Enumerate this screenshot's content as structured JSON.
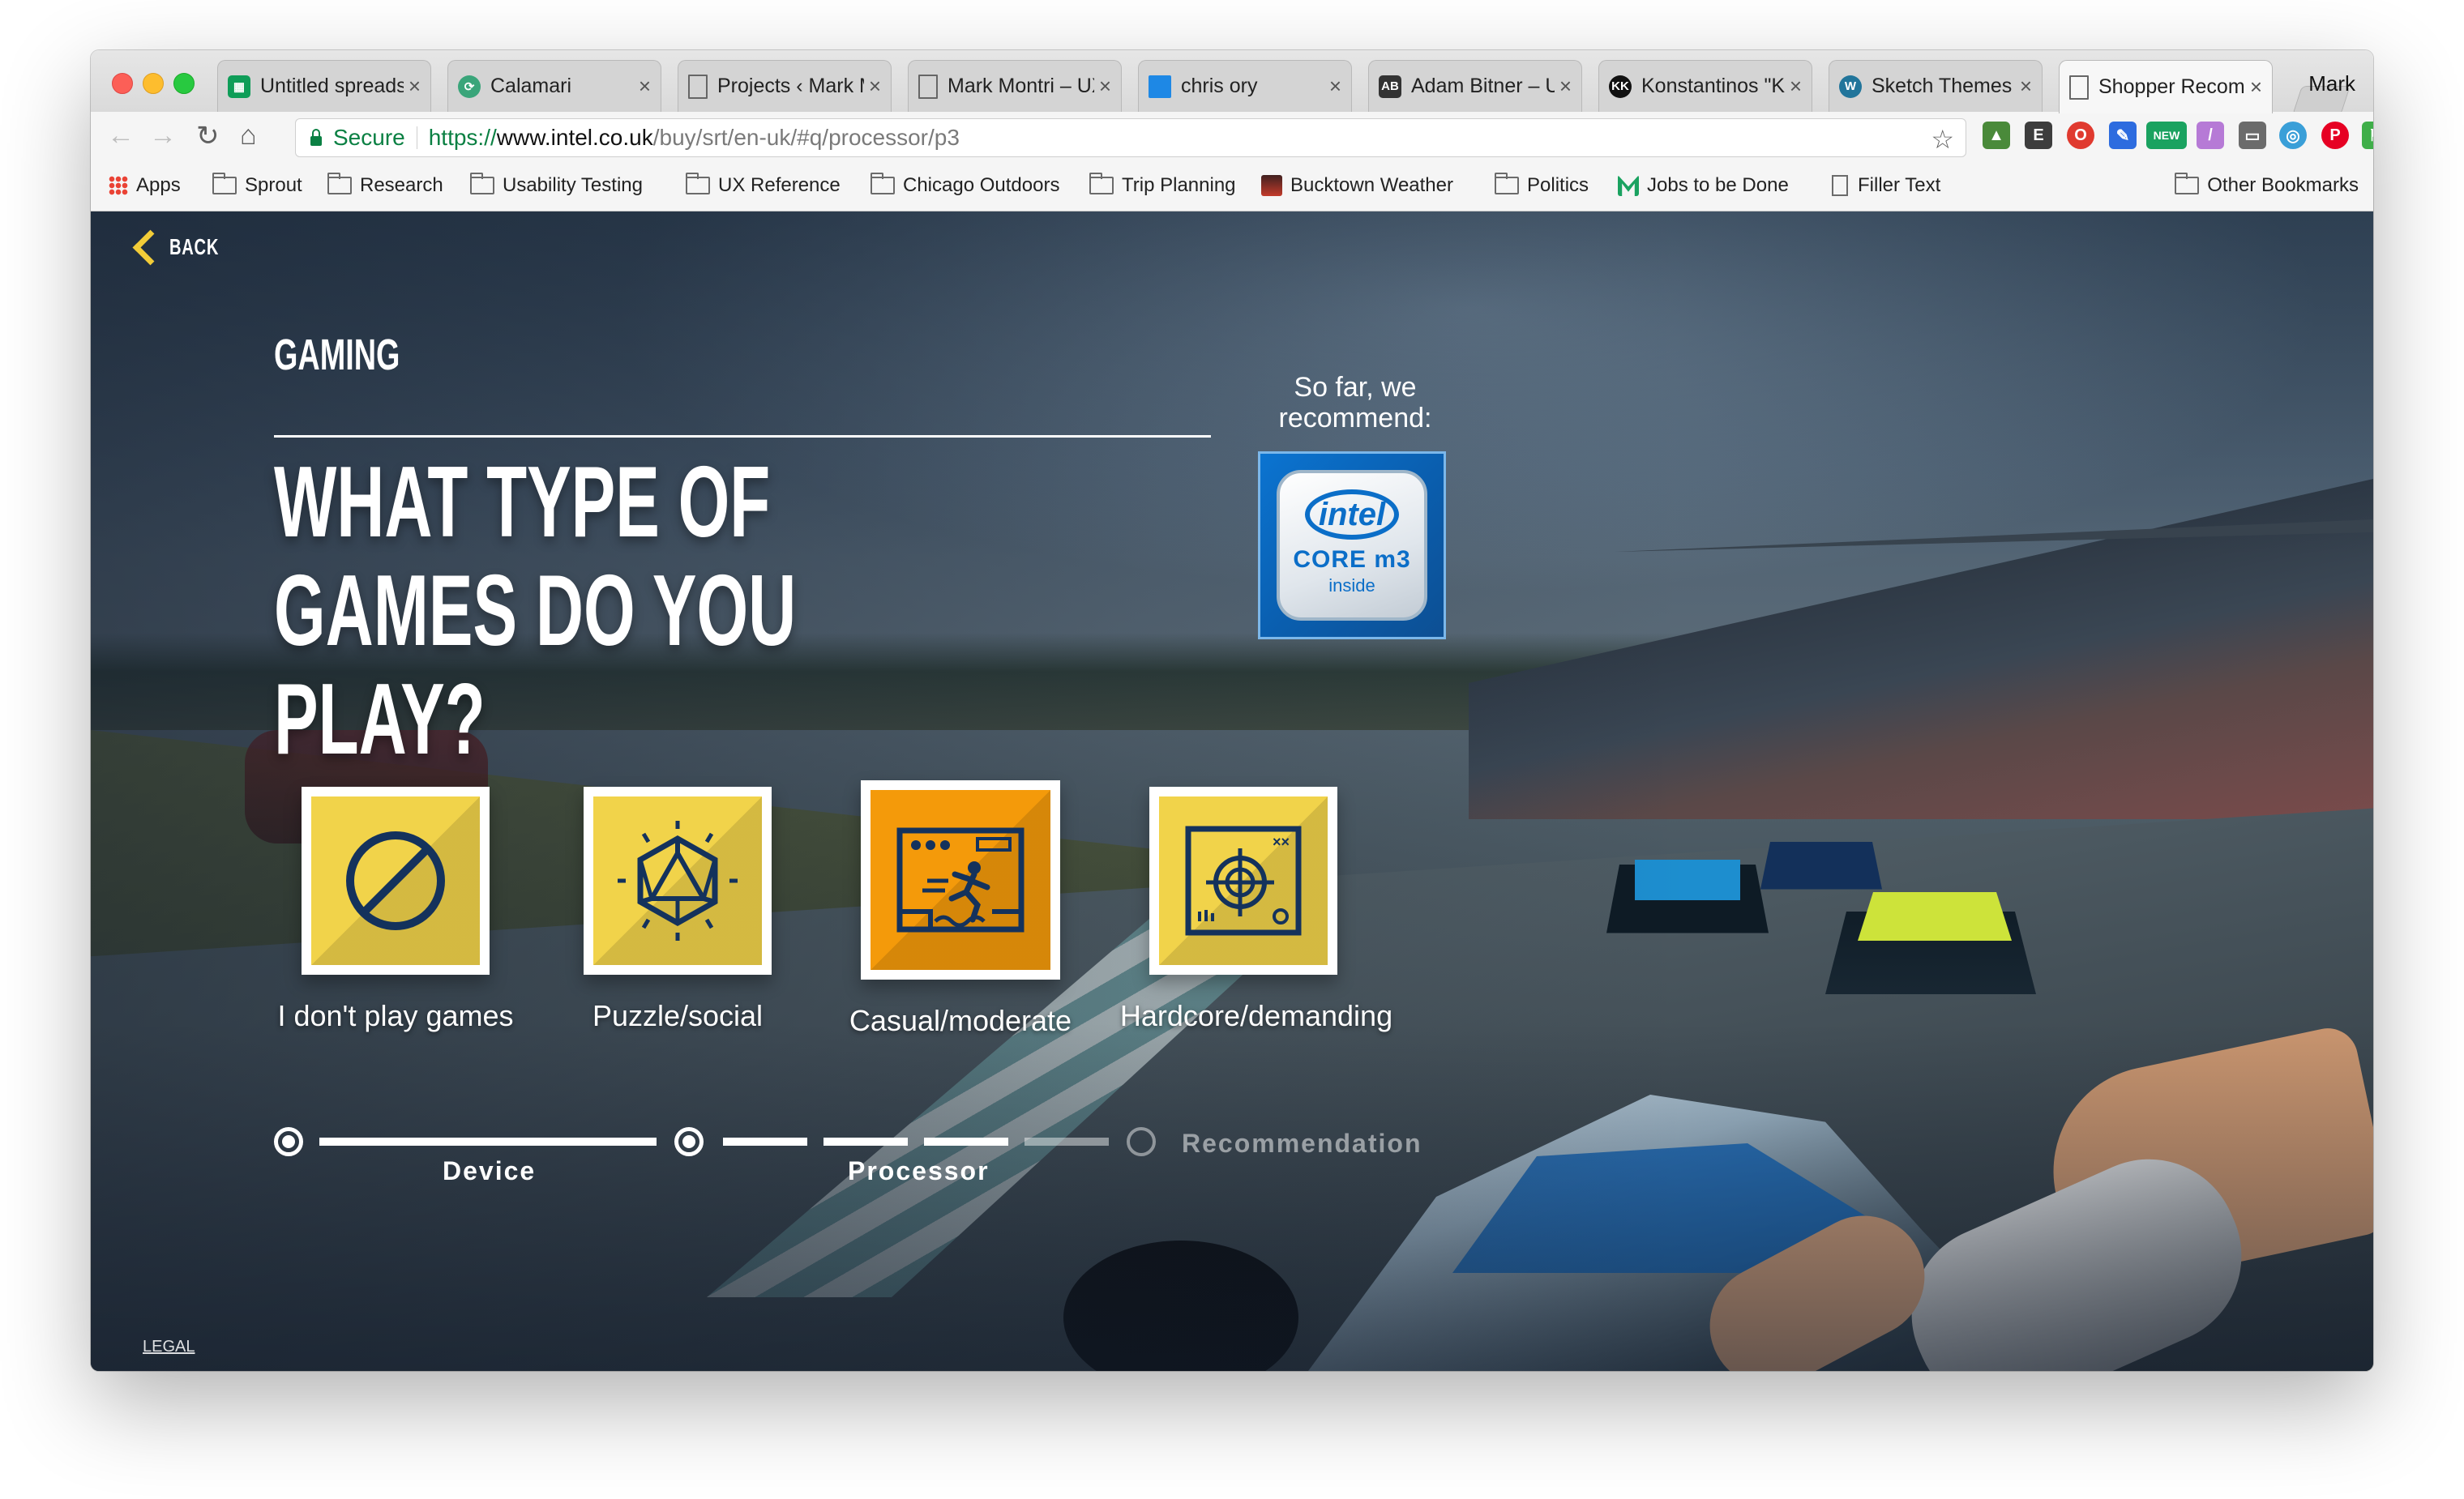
{
  "browser": {
    "profile": "Mark",
    "tabs": [
      {
        "title": "Untitled spreadsheet",
        "favicon": "sheets-icon",
        "color": "#0f9d58"
      },
      {
        "title": "Calamari",
        "favicon": "calamari-icon",
        "color": "#3aa57a"
      },
      {
        "title": "Projects ‹ Mark Montri",
        "favicon": "page-icon",
        "color": "#ffffff"
      },
      {
        "title": "Mark Montri – UX",
        "favicon": "page-icon",
        "color": "#ffffff"
      },
      {
        "title": "chris ory",
        "favicon": "blue-square-icon",
        "color": "#1e88e5"
      },
      {
        "title": "Adam Bitner – UX",
        "favicon": "ab-icon",
        "color": "#333333"
      },
      {
        "title": "Konstantinos \"Kostas\"",
        "favicon": "kk-icon",
        "color": "#111111"
      },
      {
        "title": "Sketch Themes",
        "favicon": "wordpress-icon",
        "color": "#21759b"
      },
      {
        "title": "Shopper Recommendation",
        "favicon": "page-icon",
        "color": "#ffffff"
      }
    ],
    "active_tab_index": 8,
    "address": {
      "secure_label": "Secure",
      "scheme": "https://",
      "host": "www.intel.co.uk",
      "path": "/buy/srt/en-uk/#q/processor/p3"
    },
    "extension_badge": "NEW",
    "bookmarks": [
      {
        "label": "Apps",
        "icon": "apps-grid-icon"
      },
      {
        "label": "Sprout",
        "icon": "folder-icon"
      },
      {
        "label": "Research",
        "icon": "folder-icon"
      },
      {
        "label": "Usability Testing",
        "icon": "folder-icon"
      },
      {
        "label": "UX Reference",
        "icon": "folder-icon"
      },
      {
        "label": "Chicago Outdoors",
        "icon": "folder-icon"
      },
      {
        "label": "Trip Planning",
        "icon": "folder-icon"
      },
      {
        "label": "Bucktown Weather",
        "icon": "weather-icon"
      },
      {
        "label": "Politics",
        "icon": "folder-icon"
      },
      {
        "label": "Jobs to be Done",
        "icon": "medium-icon"
      },
      {
        "label": "Filler Text",
        "icon": "page-icon"
      }
    ],
    "other_bookmarks": "Other Bookmarks"
  },
  "page": {
    "back_label": "BACK",
    "section": "GAMING",
    "question": "WHAT TYPE OF GAMES DO YOU PLAY?",
    "recommend_label": "So far, we recommend:",
    "badge": {
      "brand": "intel",
      "line": "CORE m3",
      "suffix": "inside"
    },
    "options": [
      {
        "label": "I don't play games",
        "icon": "no-games-icon",
        "selected": false
      },
      {
        "label": "Puzzle/social",
        "icon": "dice-icon",
        "selected": false
      },
      {
        "label": "Casual/moderate",
        "icon": "runner-game-icon",
        "selected": true
      },
      {
        "label": "Hardcore/demanding",
        "icon": "crosshair-icon",
        "selected": false
      }
    ],
    "progress": {
      "steps": [
        {
          "label": "Device",
          "state": "done"
        },
        {
          "label": "Processor",
          "state": "current",
          "substeps_done": 3,
          "substeps_total": 4
        },
        {
          "label": "Recommendation",
          "state": "pending"
        }
      ]
    },
    "legal_label": "LEGAL",
    "colors": {
      "accent_yellow": "#f2cc38",
      "tile_yellow": "#f1d34a",
      "tile_selected": "#f49a0a",
      "icon_navy": "#14325c"
    }
  }
}
